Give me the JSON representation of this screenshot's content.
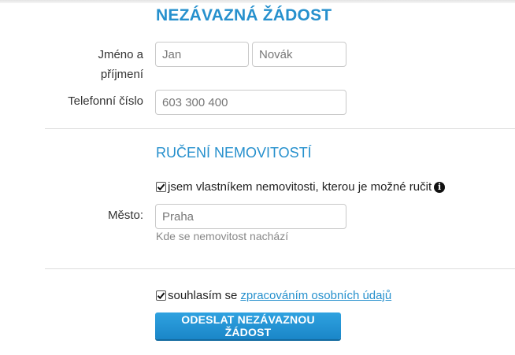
{
  "form": {
    "title": "NEZÁVAZNÁ ŽÁDOST",
    "name_label_line1": "Jméno a",
    "name_label_line2": "příjmení",
    "first_name_placeholder": "Jan",
    "last_name_placeholder": "Novák",
    "phone_label": "Telefonní číslo",
    "phone_placeholder": "603 300 400"
  },
  "property": {
    "section_title": "RUČENÍ NEMOVITOSTÍ",
    "owner_checkbox_label": "jsem vlastníkem nemovitosti, kterou je možné ručit",
    "owner_checked": true,
    "city_label": "Město:",
    "city_placeholder": "Praha",
    "city_hint": "Kde se nemovitost nachází"
  },
  "consent": {
    "text": "souhlasím se",
    "link_text": "zpracováním osobních údajů",
    "checked": true
  },
  "submit_label": "ODESLAT NEZÁVAZNOU ŽÁDOST",
  "colors": {
    "accent": "#2690cd",
    "button": "#1a86c8"
  },
  "icons": {
    "check": "check-icon",
    "info": "info-icon"
  }
}
